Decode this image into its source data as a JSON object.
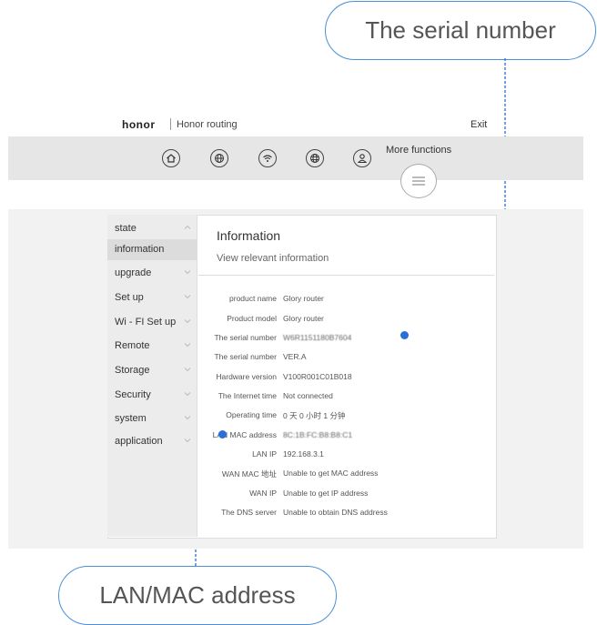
{
  "callouts": {
    "serial": "The serial number",
    "lan_mac": "LAN/MAC address"
  },
  "header": {
    "logo": "honor",
    "title": "Honor routing",
    "exit": "Exit"
  },
  "nav": {
    "more_functions": "More functions",
    "icons": [
      "home-icon",
      "globe-icon",
      "wifi-icon",
      "network-icon",
      "user-icon",
      "menu-icon"
    ]
  },
  "sidebar": {
    "items": [
      {
        "label": "state"
      },
      {
        "label": "information"
      },
      {
        "label": "upgrade"
      },
      {
        "label": "Set up"
      },
      {
        "label": "Wi - FI Set up"
      },
      {
        "label": "Remote"
      },
      {
        "label": "Storage"
      },
      {
        "label": "Security"
      },
      {
        "label": "system"
      },
      {
        "label": "application"
      }
    ],
    "active_index": 1
  },
  "info": {
    "title": "Information",
    "subtitle": "View relevant information",
    "rows": [
      {
        "label": "product name",
        "value": "Glory router"
      },
      {
        "label": "Product model",
        "value": "Glory router"
      },
      {
        "label": "The serial number",
        "value": "W6R1151180B7604"
      },
      {
        "label": "The serial number",
        "value": "VER.A"
      },
      {
        "label": "Hardware version",
        "value": "V100R001C01B018"
      },
      {
        "label": "The Internet time",
        "value": "Not connected"
      },
      {
        "label": "Operating time",
        "value": "0 天 0 小时 1 分钟"
      },
      {
        "label": "LAN MAC address",
        "value": "8C:1B:FC:B8:B8:C1"
      },
      {
        "label": "LAN IP",
        "value": "192.168.3.1"
      },
      {
        "label": "WAN MAC 地址",
        "value": "Unable to get MAC address"
      },
      {
        "label": "WAN IP",
        "value": "Unable to get IP address"
      },
      {
        "label": "The DNS server",
        "value": "Unable to obtain DNS address"
      }
    ]
  },
  "colors": {
    "accent": "#2a6fd6",
    "callout_border": "#4a8fd8",
    "nav_band": "#e6e6e6",
    "sidebar_bg": "#ececec"
  }
}
